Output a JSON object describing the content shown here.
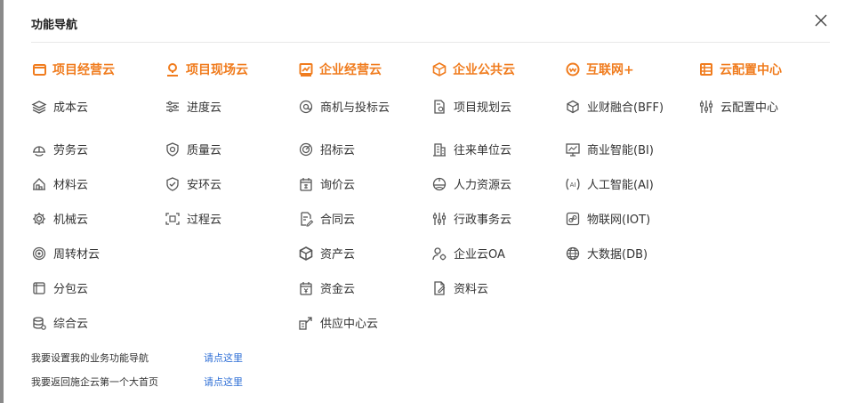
{
  "title": "功能导航",
  "accent_color": "#f07c1e",
  "link_color": "#2f6fd6",
  "columns": [
    {
      "header": "项目经营云",
      "icon": "folder-icon",
      "items": [
        {
          "label": "成本云",
          "icon": "layers-icon"
        },
        {
          "label": "劳务云",
          "icon": "helmet-icon"
        },
        {
          "label": "材料云",
          "icon": "box-stack-icon"
        },
        {
          "label": "机械云",
          "icon": "gear-icon"
        },
        {
          "label": "周转材云",
          "icon": "cycle-icon"
        },
        {
          "label": "分包云",
          "icon": "package-icon"
        },
        {
          "label": "综合云",
          "icon": "database-icon"
        }
      ]
    },
    {
      "header": "项目现场云",
      "icon": "location-icon",
      "items": [
        {
          "label": "进度云",
          "icon": "sliders-icon"
        },
        {
          "label": "质量云",
          "icon": "shield-icon"
        },
        {
          "label": "安环云",
          "icon": "shield-check-icon"
        },
        {
          "label": "过程云",
          "icon": "scan-icon"
        }
      ]
    },
    {
      "header": "企业经营云",
      "icon": "chart-icon",
      "items": [
        {
          "label": "商机与投标云",
          "icon": "at-icon"
        },
        {
          "label": "招标云",
          "icon": "target-icon"
        },
        {
          "label": "询价云",
          "icon": "calendar-price-icon"
        },
        {
          "label": "合同云",
          "icon": "document-edit-icon"
        },
        {
          "label": "资产云",
          "icon": "cube-icon"
        },
        {
          "label": "资金云",
          "icon": "calendar-money-icon"
        },
        {
          "label": "供应中心云",
          "icon": "supply-icon"
        }
      ]
    },
    {
      "header": "企业公共云",
      "icon": "cube-icon",
      "items": [
        {
          "label": "项目规划云",
          "icon": "document-chart-icon"
        },
        {
          "label": "往来单位云",
          "icon": "building-icon"
        },
        {
          "label": "人力资源云",
          "icon": "people-icon"
        },
        {
          "label": "行政事务云",
          "icon": "tuning-icon"
        },
        {
          "label": "企业云OA",
          "icon": "user-gear-icon"
        },
        {
          "label": "资料云",
          "icon": "file-edit-icon"
        }
      ]
    },
    {
      "header": "互联网+",
      "icon": "web-icon",
      "items": [
        {
          "label": "业财融合(BFF)",
          "icon": "cube-outline-icon"
        },
        {
          "label": "商业智能(BI)",
          "icon": "monitor-chart-icon"
        },
        {
          "label": "人工智能(AI)",
          "icon": "ai-icon"
        },
        {
          "label": "物联网(IOT)",
          "icon": "link-icon"
        },
        {
          "label": "大数据(DB)",
          "icon": "globe-icon"
        }
      ]
    },
    {
      "header": "云配置中心",
      "icon": "film-icon",
      "items": [
        {
          "label": "云配置中心",
          "icon": "tuning-icon"
        }
      ]
    }
  ],
  "footer": [
    {
      "text": "我要设置我的业务功能导航",
      "link": "请点这里"
    },
    {
      "text": "我要返回施企云第一个大首页",
      "link": "请点这里"
    }
  ]
}
